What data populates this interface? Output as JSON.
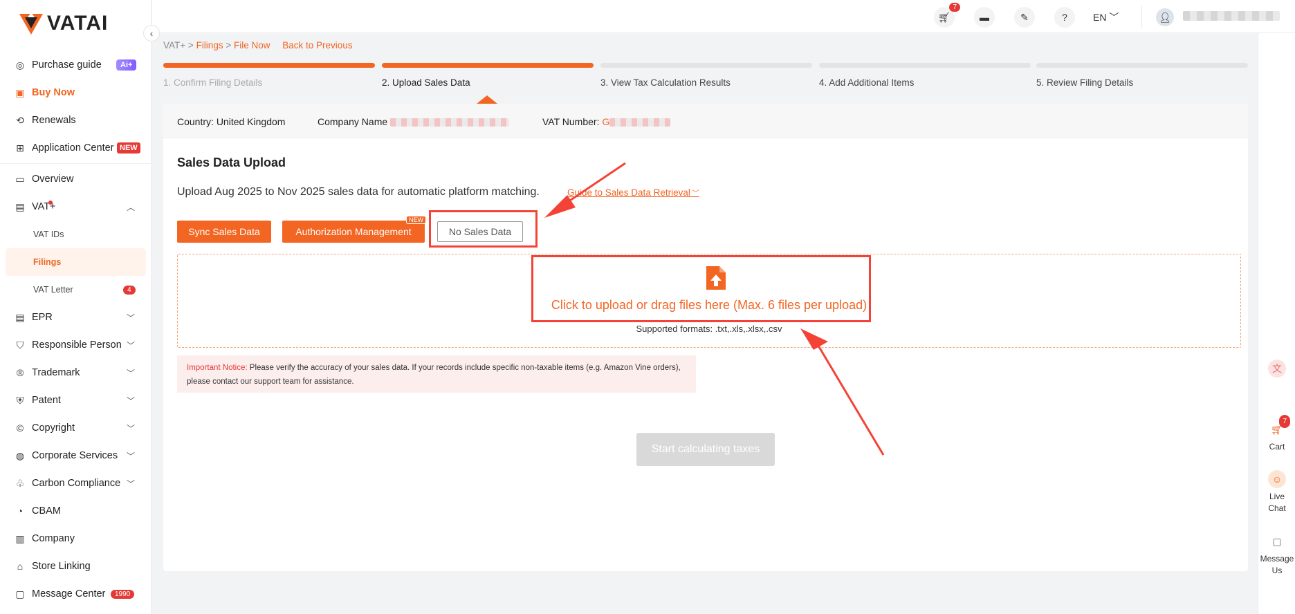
{
  "brand": {
    "name": "VATAI"
  },
  "sidebar": {
    "items": [
      {
        "label": "Purchase guide",
        "icon": "compass-icon",
        "badge": "Ai+"
      },
      {
        "label": "Buy Now",
        "icon": "shop-icon"
      },
      {
        "label": "Renewals",
        "icon": "renew-icon"
      },
      {
        "label": "Application Center",
        "icon": "apps-icon",
        "badge": "NEW"
      },
      {
        "label": "Overview",
        "icon": "monitor-icon"
      },
      {
        "label": "VAT+",
        "icon": "vat-icon"
      },
      {
        "label": "VAT IDs"
      },
      {
        "label": "Filings"
      },
      {
        "label": "VAT Letter",
        "count": "4"
      },
      {
        "label": "EPR",
        "icon": "epr-icon"
      },
      {
        "label": "Responsible Person",
        "icon": "shield-icon"
      },
      {
        "label": "Trademark",
        "icon": "trademark-icon"
      },
      {
        "label": "Patent",
        "icon": "patent-icon"
      },
      {
        "label": "Copyright",
        "icon": "copyright-icon"
      },
      {
        "label": "Corporate Services",
        "icon": "globe-icon"
      },
      {
        "label": "Carbon Compliance",
        "icon": "leaf-icon"
      },
      {
        "label": "CBAM",
        "icon": "cbam-icon"
      },
      {
        "label": "Company",
        "icon": "building-icon"
      },
      {
        "label": "Store Linking",
        "icon": "store-icon"
      },
      {
        "label": "Message Center",
        "icon": "message-icon",
        "count": "1990"
      }
    ]
  },
  "header": {
    "cart_count": "7",
    "language": "EN"
  },
  "breadcrumb": {
    "root": "VAT+",
    "sep": ">",
    "level1": "Filings",
    "level2": "File Now",
    "back": "Back to Previous"
  },
  "steps": [
    {
      "label": "1. Confirm Filing Details",
      "state": "done"
    },
    {
      "label": "2. Upload Sales Data",
      "state": "current"
    },
    {
      "label": "3. View Tax Calculation Results",
      "state": "todo"
    },
    {
      "label": "4. Add Additional Items",
      "state": "todo"
    },
    {
      "label": "5. Review Filing Details",
      "state": "todo"
    }
  ],
  "info": {
    "country_label": "Country:",
    "country": "United Kingdom",
    "company_label": "Company Name",
    "vat_label": "VAT Number:",
    "vat_prefix": "G"
  },
  "upload_section": {
    "title": "Sales Data Upload",
    "description": "Upload Aug 2025 to Nov 2025 sales data for automatic platform matching.",
    "guide_link": "Guide to Sales Data Retrieval",
    "sync_button": "Sync Sales Data",
    "auth_button": "Authorization Management",
    "auth_badge": "NEW",
    "no_data_button": "No Sales Data",
    "dropzone_text": "Click to upload or drag files here (Max. 6 files per upload)",
    "formats": "Supported formats: .txt,.xls,.xlsx,.csv",
    "notice_title": "Important Notice:",
    "notice_text": "Please verify the accuracy of your sales data. If your records include specific non-taxable items (e.g. Amazon Vine orders), please contact our support team for assistance.",
    "calc_button": "Start calculating taxes"
  },
  "rightbar": {
    "cart": "Cart",
    "cart_count": "7",
    "live_chat": "Live Chat",
    "message": "Message Us"
  },
  "colors": {
    "accent": "#f26522",
    "annotation": "#f44336"
  }
}
